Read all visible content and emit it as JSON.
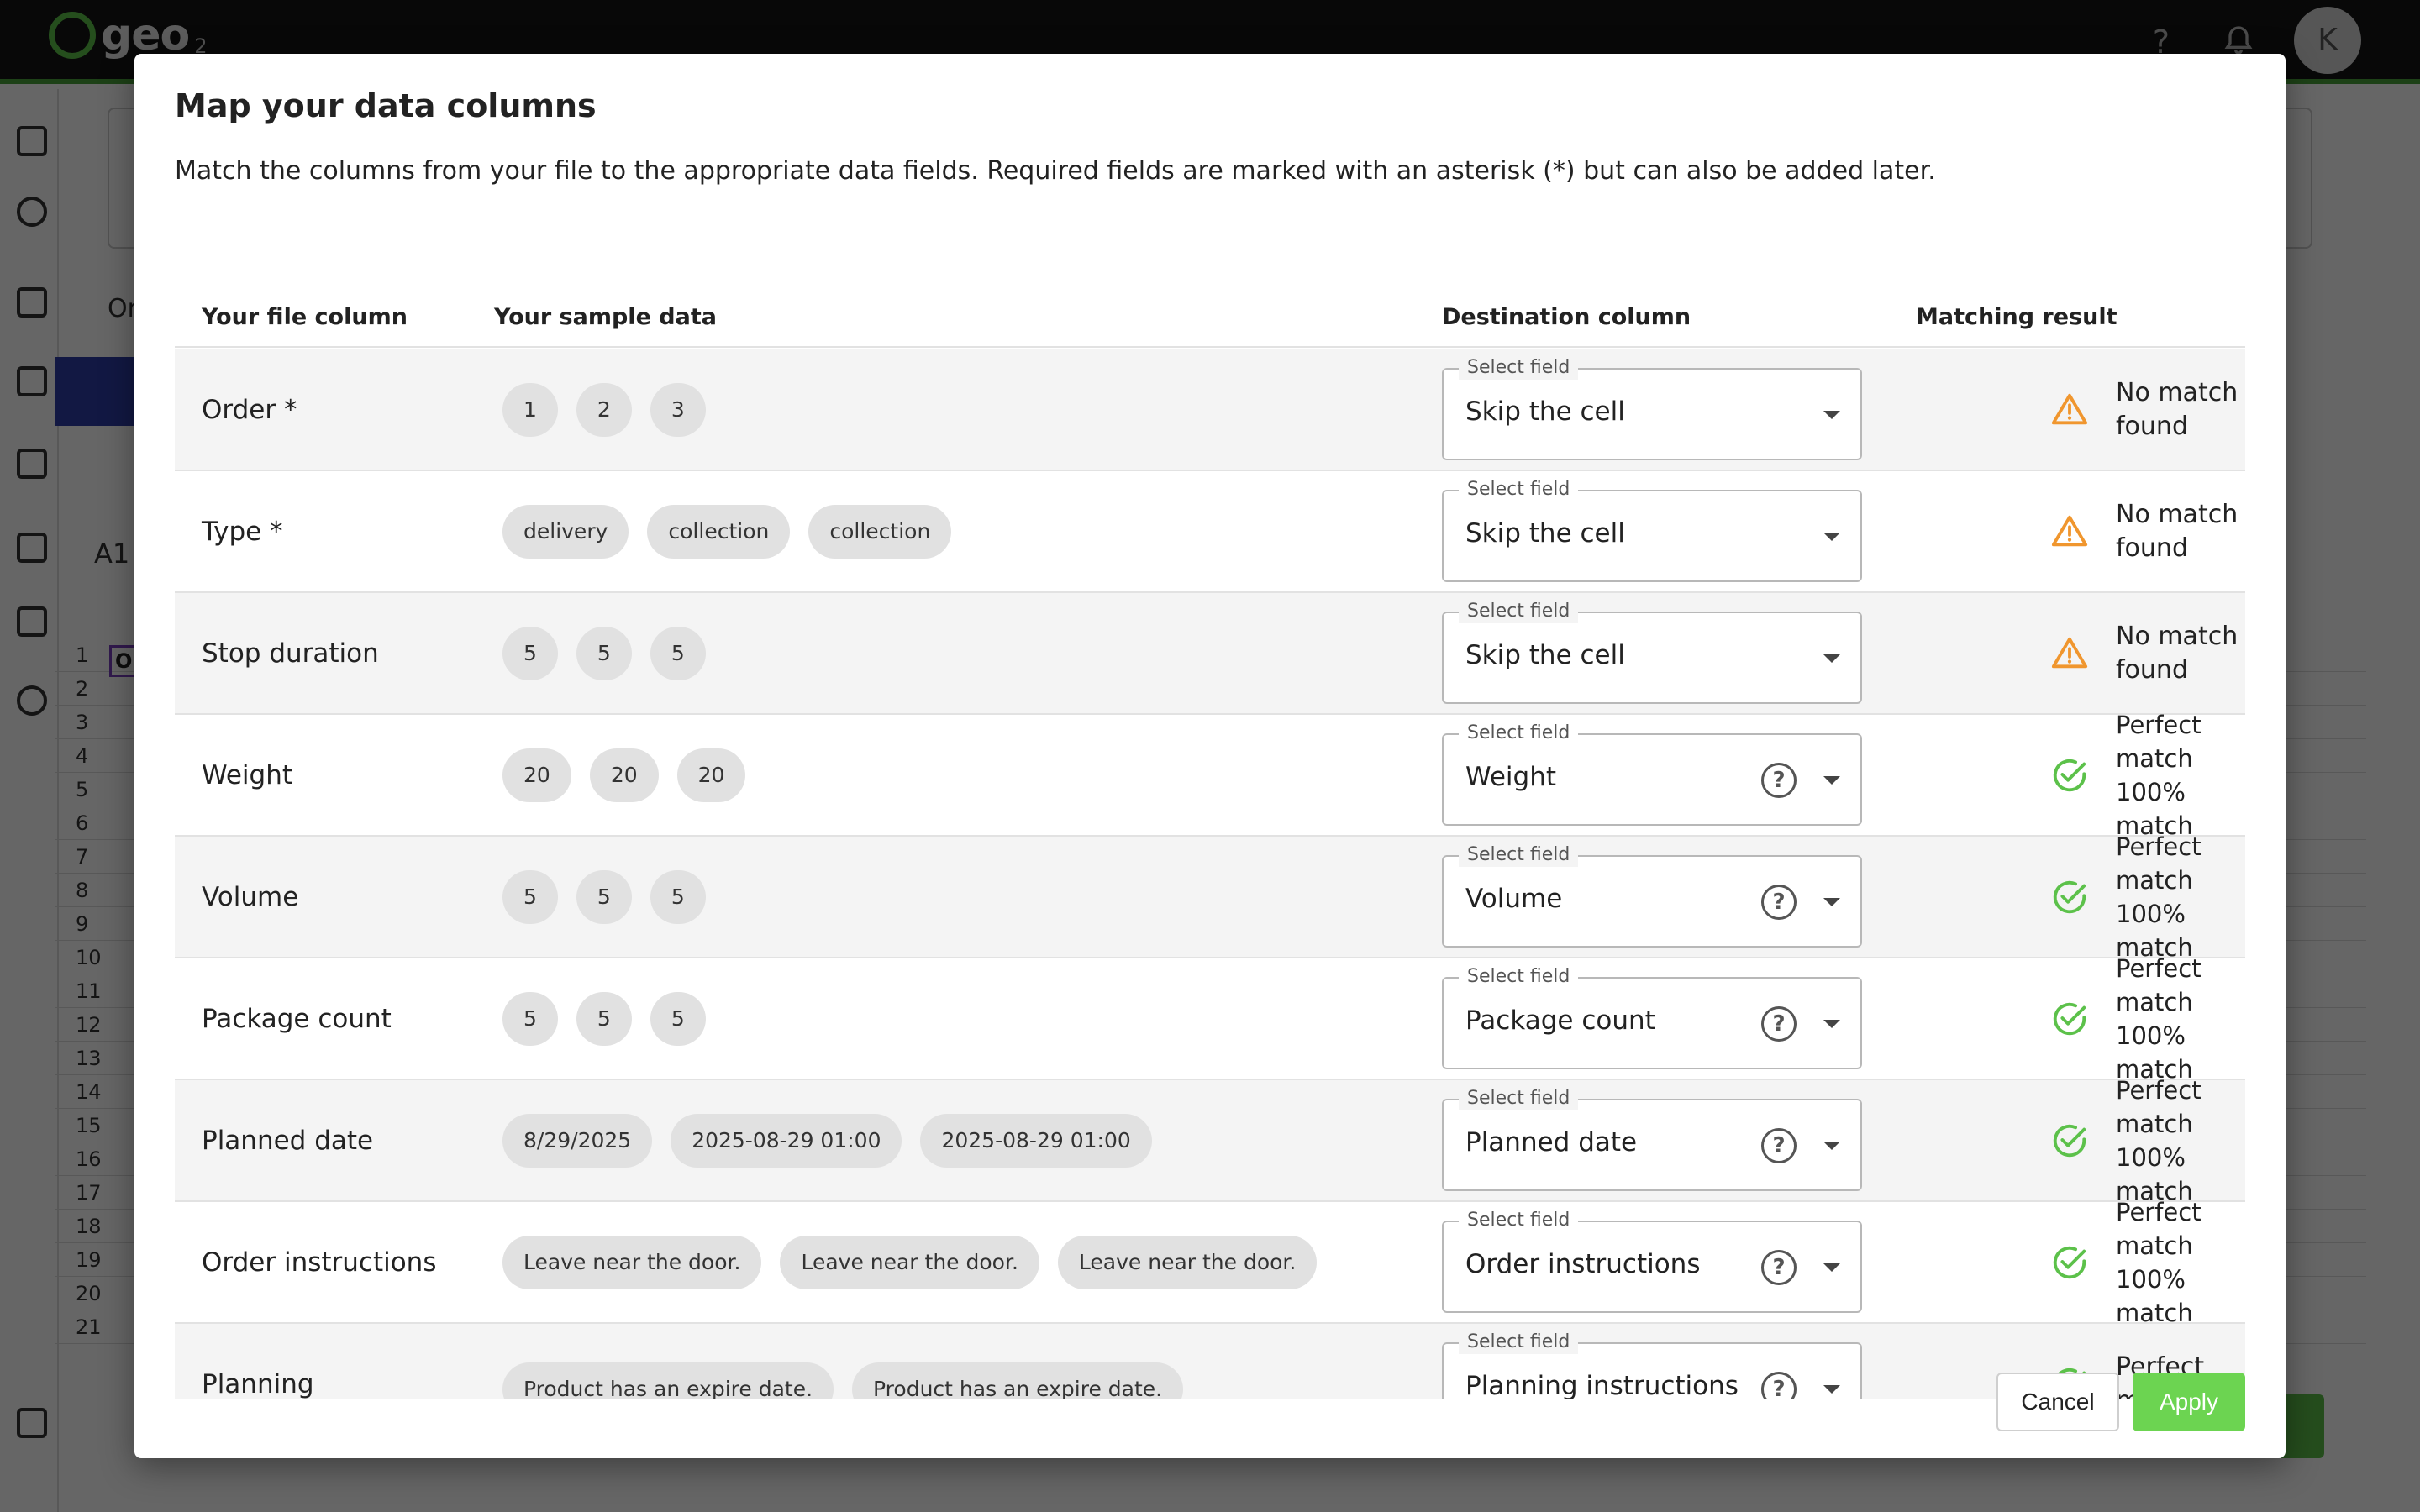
{
  "background": {
    "logo_text": "geo",
    "logo_sub": "2",
    "avatar_initial": "K",
    "cell_ref": "A1",
    "tab_label": "Or",
    "first_cell_text": "Or",
    "row_numbers": [
      "1",
      "2",
      "3",
      "4",
      "5",
      "6",
      "7",
      "8",
      "9",
      "10",
      "11",
      "12",
      "13",
      "14",
      "15",
      "16",
      "17",
      "18",
      "19",
      "20",
      "21"
    ]
  },
  "modal": {
    "title": "Map your data columns",
    "description": "Match the columns from your file to the appropriate data fields. Required fields are marked with an asterisk (*) but can also be added later.",
    "headers": {
      "file_column": "Your file column",
      "sample_data": "Your sample data",
      "destination": "Destination column",
      "result": "Matching result"
    },
    "select_legend": "Select field",
    "rows": [
      {
        "label": "Order *",
        "samples": [
          "1",
          "2",
          "3"
        ],
        "destination": "Skip the cell",
        "has_help": false,
        "status": "warning",
        "result_line1": "No match found",
        "result_line2": ""
      },
      {
        "label": "Type *",
        "samples": [
          "delivery",
          "collection",
          "collection"
        ],
        "destination": "Skip the cell",
        "has_help": false,
        "status": "warning",
        "result_line1": "No match found",
        "result_line2": ""
      },
      {
        "label": "Stop duration",
        "samples": [
          "5",
          "5",
          "5"
        ],
        "destination": "Skip the cell",
        "has_help": false,
        "status": "warning",
        "result_line1": "No match found",
        "result_line2": ""
      },
      {
        "label": "Weight",
        "samples": [
          "20",
          "20",
          "20"
        ],
        "destination": "Weight",
        "has_help": true,
        "status": "success",
        "result_line1": "Perfect match",
        "result_line2": "100% match"
      },
      {
        "label": "Volume",
        "samples": [
          "5",
          "5",
          "5"
        ],
        "destination": "Volume",
        "has_help": true,
        "status": "success",
        "result_line1": "Perfect match",
        "result_line2": "100% match"
      },
      {
        "label": "Package count",
        "samples": [
          "5",
          "5",
          "5"
        ],
        "destination": "Package count",
        "has_help": true,
        "status": "success",
        "result_line1": "Perfect match",
        "result_line2": "100% match"
      },
      {
        "label": "Planned date",
        "samples": [
          "8/29/2025",
          "2025-08-29 01:00",
          "2025-08-29 01:00"
        ],
        "destination": "Planned date",
        "has_help": true,
        "status": "success",
        "result_line1": "Perfect match",
        "result_line2": "100% match"
      },
      {
        "label": "Order instructions",
        "samples": [
          "Leave near the door.",
          "Leave near the door.",
          "Leave near the door."
        ],
        "destination": "Order instructions",
        "has_help": true,
        "status": "success",
        "result_line1": "Perfect match",
        "result_line2": "100% match"
      },
      {
        "label": "Planning",
        "samples": [
          "Product has an expire date.",
          "Product has an expire date."
        ],
        "destination": "Planning instructions",
        "has_help": true,
        "status": "success",
        "result_line1": "Perfect match",
        "result_line2": ""
      }
    ],
    "cancel_label": "Cancel",
    "apply_label": "Apply"
  },
  "colors": {
    "warning": "#f0962e",
    "success": "#5cc14a",
    "apply": "#6cd451",
    "backdrop": "rgba(0,0,0,0.60)"
  },
  "icons": {
    "warning": "warning-triangle-icon",
    "success": "check-circle-icon",
    "help": "help-circle-icon",
    "caret": "caret-down-icon"
  }
}
